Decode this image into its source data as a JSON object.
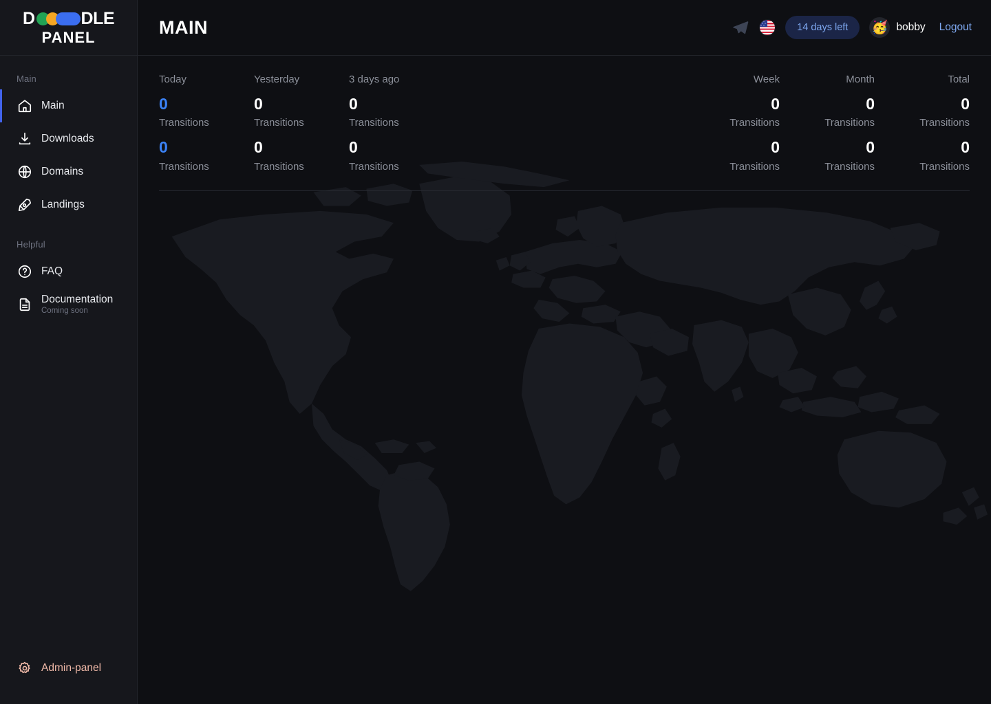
{
  "brand": {
    "line1_prefix": "D",
    "line1_suffix": "DLE",
    "line2": "PANEL",
    "colors": {
      "green": "#23a455",
      "yellow": "#f5a623",
      "blue": "#3b6ef0"
    }
  },
  "sidebar": {
    "sections": [
      {
        "label": "Main",
        "items": [
          {
            "label": "Main",
            "icon": "home-icon",
            "active": true
          },
          {
            "label": "Downloads",
            "icon": "download-icon",
            "active": false
          },
          {
            "label": "Domains",
            "icon": "globe-icon",
            "active": false
          },
          {
            "label": "Landings",
            "icon": "pen-nib-icon",
            "active": false
          }
        ]
      },
      {
        "label": "Helpful",
        "items": [
          {
            "label": "FAQ",
            "icon": "question-circle-icon",
            "active": false
          },
          {
            "label": "Documentation",
            "sub": "Coming soon",
            "icon": "document-icon",
            "active": false
          }
        ]
      }
    ],
    "footer": {
      "label": "Admin-panel",
      "icon": "gear-icon",
      "color": "#f0b9a8"
    },
    "active_indicator_color": "#4263eb"
  },
  "header": {
    "title": "MAIN",
    "telegram_icon": "telegram-icon",
    "language_flag": "us-flag-icon",
    "days_badge": "14 days left",
    "avatar_emoji": "🥳",
    "username": "bobby",
    "logout": "Logout",
    "badge_bg": "#1b2547",
    "badge_text_color": "#7ea8f0",
    "link_color": "#7ea8f0"
  },
  "stats": {
    "accent_color": "#3b82f6",
    "sub_label": "Transitions",
    "columns_left": [
      {
        "header": "Today",
        "row1": "0",
        "row2": "0",
        "accent": true
      },
      {
        "header": "Yesterday",
        "row1": "0",
        "row2": "0",
        "accent": false
      },
      {
        "header": "3 days ago",
        "row1": "0",
        "row2": "0",
        "accent": false
      }
    ],
    "columns_right": [
      {
        "header": "Week",
        "row1": "0",
        "row2": "0"
      },
      {
        "header": "Month",
        "row1": "0",
        "row2": "0"
      },
      {
        "header": "Total",
        "row1": "0",
        "row2": "0"
      }
    ]
  },
  "map": {
    "name": "world-map-background",
    "fill": "#191b21"
  }
}
